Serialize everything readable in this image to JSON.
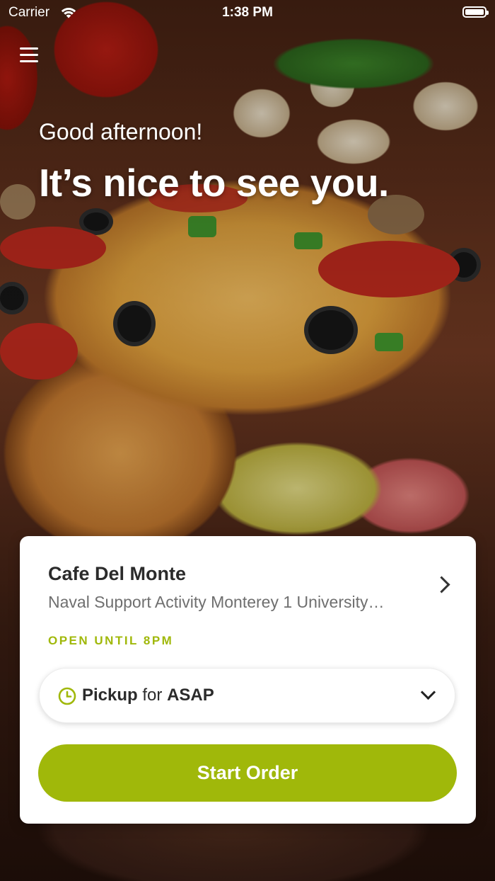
{
  "status_bar": {
    "carrier": "Carrier",
    "time": "1:38 PM",
    "wifi_icon": "wifi-icon",
    "battery_icon": "battery-icon",
    "battery_level": 1.0
  },
  "header": {
    "menu_icon": "hamburger-menu-icon",
    "greeting": "Good afternoon!",
    "headline": "It’s nice to see you."
  },
  "location": {
    "name": "Cafe Del Monte",
    "address": "Naval Support Activity Monterey 1 University…",
    "hours": "OPEN UNTIL 8PM",
    "chevron_icon": "chevron-right-icon"
  },
  "order_mode": {
    "icon": "clock-icon",
    "mode": "Pickup",
    "connector": "for",
    "time": "ASAP",
    "dropdown_icon": "chevron-down-icon"
  },
  "actions": {
    "start_order": "Start Order"
  },
  "colors": {
    "accent": "#a0b80a",
    "card_bg": "#ffffff",
    "title_text": "#2b2b2b",
    "secondary_text": "#6f6f6f"
  }
}
